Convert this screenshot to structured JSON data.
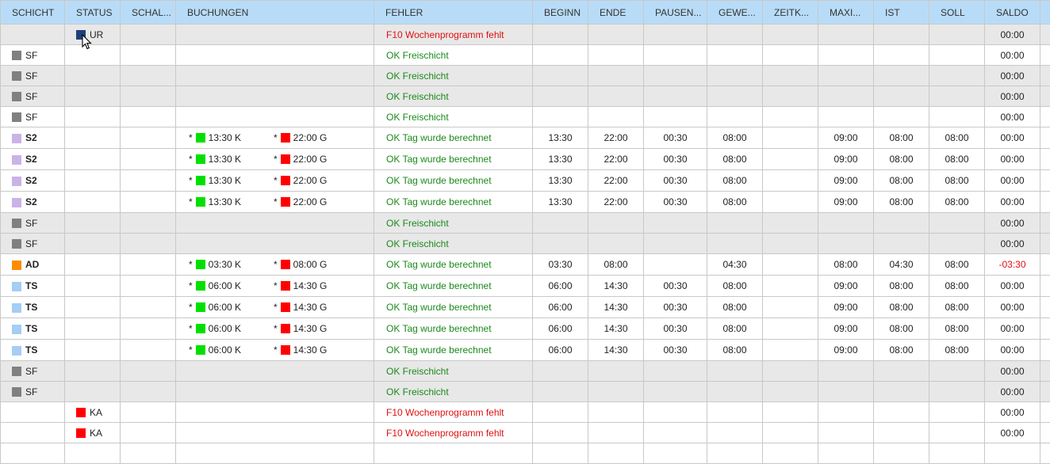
{
  "columns": [
    "SCHICHT",
    "STATUS",
    "SCHAL...",
    "BUCHUNGEN",
    "FEHLER",
    "BEGINN",
    "ENDE",
    "PAUSEN...",
    "GEWE...",
    "ZEITK...",
    "MAXI...",
    "IST",
    "SOLL",
    "SALDO"
  ],
  "colors": {
    "grey": "#808080",
    "lilac": "#c9b3e8",
    "orange": "#ff8c00",
    "lightblue": "#a5cdf5",
    "green": "#00e000",
    "red": "#ff0000",
    "navy": "#1f3f7a"
  },
  "rows": [
    {
      "bg": "grey",
      "shift_color": "",
      "shift": "",
      "bold": false,
      "status_color": "navy",
      "status": "UR",
      "in": null,
      "out": null,
      "fehler": "F10 Wochenprogramm fehlt",
      "ftype": "err",
      "beginn": "",
      "ende": "",
      "pause": "",
      "gewe": "",
      "zeitk": "",
      "maxi": "",
      "ist": "",
      "soll": "",
      "saldo": "00:00"
    },
    {
      "bg": "white",
      "shift_color": "grey",
      "shift": "SF",
      "bold": false,
      "status_color": "",
      "status": "",
      "in": null,
      "out": null,
      "fehler": "OK Freischicht",
      "ftype": "ok",
      "beginn": "",
      "ende": "",
      "pause": "",
      "gewe": "",
      "zeitk": "",
      "maxi": "",
      "ist": "",
      "soll": "",
      "saldo": "00:00"
    },
    {
      "bg": "grey",
      "shift_color": "grey",
      "shift": "SF",
      "bold": false,
      "status_color": "",
      "status": "",
      "in": null,
      "out": null,
      "fehler": "OK Freischicht",
      "ftype": "ok",
      "beginn": "",
      "ende": "",
      "pause": "",
      "gewe": "",
      "zeitk": "",
      "maxi": "",
      "ist": "",
      "soll": "",
      "saldo": "00:00"
    },
    {
      "bg": "grey",
      "shift_color": "grey",
      "shift": "SF",
      "bold": false,
      "status_color": "",
      "status": "",
      "in": null,
      "out": null,
      "fehler": "OK Freischicht",
      "ftype": "ok",
      "beginn": "",
      "ende": "",
      "pause": "",
      "gewe": "",
      "zeitk": "",
      "maxi": "",
      "ist": "",
      "soll": "",
      "saldo": "00:00"
    },
    {
      "bg": "white",
      "shift_color": "grey",
      "shift": "SF",
      "bold": false,
      "status_color": "",
      "status": "",
      "in": null,
      "out": null,
      "fehler": "OK Freischicht",
      "ftype": "ok",
      "beginn": "",
      "ende": "",
      "pause": "",
      "gewe": "",
      "zeitk": "",
      "maxi": "",
      "ist": "",
      "soll": "",
      "saldo": "00:00"
    },
    {
      "bg": "white",
      "tall": true,
      "shift_color": "lilac",
      "shift": "S2",
      "bold": true,
      "status_color": "",
      "status": "",
      "in": "13:30 K",
      "out": "22:00 G",
      "fehler": "OK Tag wurde berechnet",
      "ftype": "ok",
      "beginn": "13:30",
      "ende": "22:00",
      "pause": "00:30",
      "gewe": "08:00",
      "zeitk": "",
      "maxi": "09:00",
      "ist": "08:00",
      "soll": "08:00",
      "saldo": "00:00"
    },
    {
      "bg": "white",
      "tall": true,
      "shift_color": "lilac",
      "shift": "S2",
      "bold": true,
      "status_color": "",
      "status": "",
      "in": "13:30 K",
      "out": "22:00 G",
      "fehler": "OK Tag wurde berechnet",
      "ftype": "ok",
      "beginn": "13:30",
      "ende": "22:00",
      "pause": "00:30",
      "gewe": "08:00",
      "zeitk": "",
      "maxi": "09:00",
      "ist": "08:00",
      "soll": "08:00",
      "saldo": "00:00"
    },
    {
      "bg": "white",
      "tall": true,
      "shift_color": "lilac",
      "shift": "S2",
      "bold": true,
      "status_color": "",
      "status": "",
      "in": "13:30 K",
      "out": "22:00 G",
      "fehler": "OK Tag wurde berechnet",
      "ftype": "ok",
      "beginn": "13:30",
      "ende": "22:00",
      "pause": "00:30",
      "gewe": "08:00",
      "zeitk": "",
      "maxi": "09:00",
      "ist": "08:00",
      "soll": "08:00",
      "saldo": "00:00"
    },
    {
      "bg": "white",
      "tall": true,
      "shift_color": "lilac",
      "shift": "S2",
      "bold": true,
      "status_color": "",
      "status": "",
      "in": "13:30 K",
      "out": "22:00 G",
      "fehler": "OK Tag wurde berechnet",
      "ftype": "ok",
      "beginn": "13:30",
      "ende": "22:00",
      "pause": "00:30",
      "gewe": "08:00",
      "zeitk": "",
      "maxi": "09:00",
      "ist": "08:00",
      "soll": "08:00",
      "saldo": "00:00"
    },
    {
      "bg": "grey",
      "shift_color": "grey",
      "shift": "SF",
      "bold": false,
      "status_color": "",
      "status": "",
      "in": null,
      "out": null,
      "fehler": "OK Freischicht",
      "ftype": "ok",
      "beginn": "",
      "ende": "",
      "pause": "",
      "gewe": "",
      "zeitk": "",
      "maxi": "",
      "ist": "",
      "soll": "",
      "saldo": "00:00"
    },
    {
      "bg": "grey",
      "shift_color": "grey",
      "shift": "SF",
      "bold": false,
      "status_color": "",
      "status": "",
      "in": null,
      "out": null,
      "fehler": "OK Freischicht",
      "ftype": "ok",
      "beginn": "",
      "ende": "",
      "pause": "",
      "gewe": "",
      "zeitk": "",
      "maxi": "",
      "ist": "",
      "soll": "",
      "saldo": "00:00"
    },
    {
      "bg": "white",
      "tall": true,
      "shift_color": "orange",
      "shift": "AD",
      "bold": true,
      "status_color": "",
      "status": "",
      "in": "03:30 K",
      "out": "08:00 G",
      "fehler": "OK Tag wurde berechnet",
      "ftype": "ok",
      "beginn": "03:30",
      "ende": "08:00",
      "pause": "",
      "gewe": "04:30",
      "zeitk": "",
      "maxi": "08:00",
      "ist": "04:30",
      "soll": "08:00",
      "saldo": "-03:30"
    },
    {
      "bg": "white",
      "tall": true,
      "shift_color": "lightblue",
      "shift": "TS",
      "bold": true,
      "status_color": "",
      "status": "",
      "in": "06:00 K",
      "out": "14:30 G",
      "fehler": "OK Tag wurde berechnet",
      "ftype": "ok",
      "beginn": "06:00",
      "ende": "14:30",
      "pause": "00:30",
      "gewe": "08:00",
      "zeitk": "",
      "maxi": "09:00",
      "ist": "08:00",
      "soll": "08:00",
      "saldo": "00:00"
    },
    {
      "bg": "white",
      "tall": true,
      "shift_color": "lightblue",
      "shift": "TS",
      "bold": true,
      "status_color": "",
      "status": "",
      "in": "06:00 K",
      "out": "14:30 G",
      "fehler": "OK Tag wurde berechnet",
      "ftype": "ok",
      "beginn": "06:00",
      "ende": "14:30",
      "pause": "00:30",
      "gewe": "08:00",
      "zeitk": "",
      "maxi": "09:00",
      "ist": "08:00",
      "soll": "08:00",
      "saldo": "00:00"
    },
    {
      "bg": "white",
      "tall": true,
      "shift_color": "lightblue",
      "shift": "TS",
      "bold": true,
      "status_color": "",
      "status": "",
      "in": "06:00 K",
      "out": "14:30 G",
      "fehler": "OK Tag wurde berechnet",
      "ftype": "ok",
      "beginn": "06:00",
      "ende": "14:30",
      "pause": "00:30",
      "gewe": "08:00",
      "zeitk": "",
      "maxi": "09:00",
      "ist": "08:00",
      "soll": "08:00",
      "saldo": "00:00"
    },
    {
      "bg": "white",
      "tall": true,
      "shift_color": "lightblue",
      "shift": "TS",
      "bold": true,
      "status_color": "",
      "status": "",
      "in": "06:00 K",
      "out": "14:30 G",
      "fehler": "OK Tag wurde berechnet",
      "ftype": "ok",
      "beginn": "06:00",
      "ende": "14:30",
      "pause": "00:30",
      "gewe": "08:00",
      "zeitk": "",
      "maxi": "09:00",
      "ist": "08:00",
      "soll": "08:00",
      "saldo": "00:00"
    },
    {
      "bg": "grey",
      "shift_color": "grey",
      "shift": "SF",
      "bold": false,
      "status_color": "",
      "status": "",
      "in": null,
      "out": null,
      "fehler": "OK Freischicht",
      "ftype": "ok",
      "beginn": "",
      "ende": "",
      "pause": "",
      "gewe": "",
      "zeitk": "",
      "maxi": "",
      "ist": "",
      "soll": "",
      "saldo": "00:00"
    },
    {
      "bg": "grey",
      "shift_color": "grey",
      "shift": "SF",
      "bold": false,
      "status_color": "",
      "status": "",
      "in": null,
      "out": null,
      "fehler": "OK Freischicht",
      "ftype": "ok",
      "beginn": "",
      "ende": "",
      "pause": "",
      "gewe": "",
      "zeitk": "",
      "maxi": "",
      "ist": "",
      "soll": "",
      "saldo": "00:00"
    },
    {
      "bg": "white",
      "shift_color": "",
      "shift": "",
      "bold": false,
      "status_color": "red",
      "status": "KA",
      "in": null,
      "out": null,
      "fehler": "F10 Wochenprogramm fehlt",
      "ftype": "err",
      "beginn": "",
      "ende": "",
      "pause": "",
      "gewe": "",
      "zeitk": "",
      "maxi": "",
      "ist": "",
      "soll": "",
      "saldo": "00:00"
    },
    {
      "bg": "white",
      "shift_color": "",
      "shift": "",
      "bold": false,
      "status_color": "red",
      "status": "KA",
      "in": null,
      "out": null,
      "fehler": "F10 Wochenprogramm fehlt",
      "ftype": "err",
      "beginn": "",
      "ende": "",
      "pause": "",
      "gewe": "",
      "zeitk": "",
      "maxi": "",
      "ist": "",
      "soll": "",
      "saldo": "00:00"
    },
    {
      "bg": "white",
      "shift_color": "",
      "shift": "",
      "bold": false,
      "status_color": "",
      "status": "",
      "in": null,
      "out": null,
      "fehler": "",
      "ftype": "ok",
      "beginn": "",
      "ende": "",
      "pause": "",
      "gewe": "",
      "zeitk": "",
      "maxi": "",
      "ist": "",
      "soll": "",
      "saldo": ""
    }
  ]
}
